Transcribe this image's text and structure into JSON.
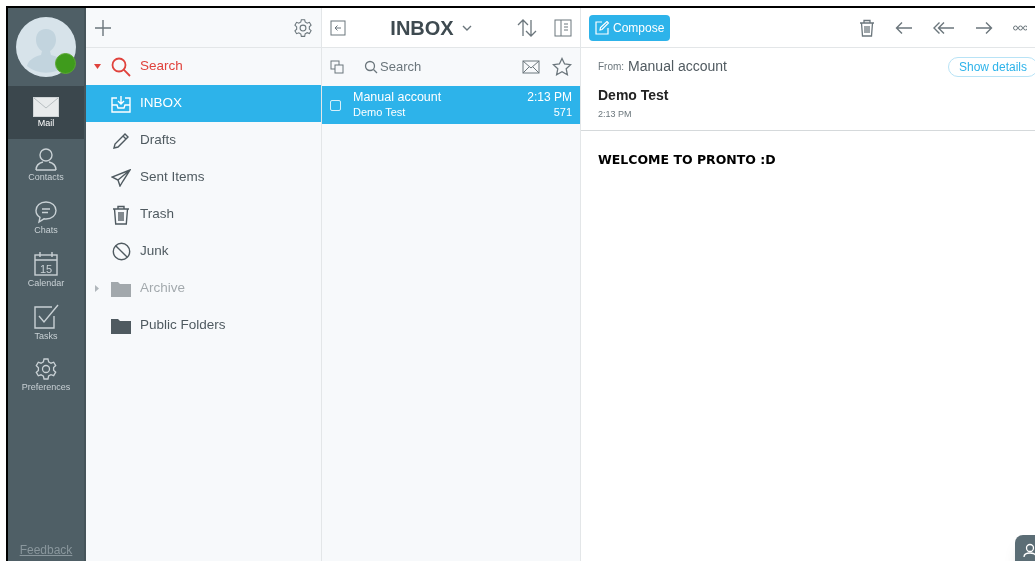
{
  "rail": {
    "items": [
      {
        "label": "Mail",
        "selected": true
      },
      {
        "label": "Contacts",
        "selected": false
      },
      {
        "label": "Chats",
        "selected": false
      },
      {
        "label": "Calendar",
        "selected": false,
        "day": "15"
      },
      {
        "label": "Tasks",
        "selected": false
      },
      {
        "label": "Preferences",
        "selected": false
      }
    ],
    "feedback": "Feedback",
    "online": true
  },
  "folders": {
    "items": [
      {
        "label": "Search",
        "kind": "search",
        "expanded": true,
        "selected": false,
        "disabled": false
      },
      {
        "label": "INBOX",
        "kind": "inbox",
        "selected": true,
        "disabled": false
      },
      {
        "label": "Drafts",
        "kind": "drafts",
        "selected": false,
        "disabled": false
      },
      {
        "label": "Sent Items",
        "kind": "sent",
        "selected": false,
        "disabled": false
      },
      {
        "label": "Trash",
        "kind": "trash",
        "selected": false,
        "disabled": false
      },
      {
        "label": "Junk",
        "kind": "junk",
        "selected": false,
        "disabled": false
      },
      {
        "label": "Archive",
        "kind": "folder",
        "expanded": false,
        "selected": false,
        "disabled": true
      },
      {
        "label": "Public Folders",
        "kind": "folder",
        "selected": false,
        "disabled": false
      }
    ]
  },
  "message_list": {
    "title": "INBOX",
    "search": {
      "placeholder": "Search"
    },
    "messages": [
      {
        "from": "Manual account",
        "subject": "Demo Test",
        "time": "2:13 PM",
        "size": "571",
        "selected": true,
        "checked": false
      }
    ]
  },
  "reader": {
    "compose": "Compose",
    "from_label": "From:",
    "from": "Manual account",
    "show_details": "Show details",
    "subject": "Demo Test",
    "time": "2:13 PM",
    "body": "WELCOME TO PRONTO :D"
  }
}
